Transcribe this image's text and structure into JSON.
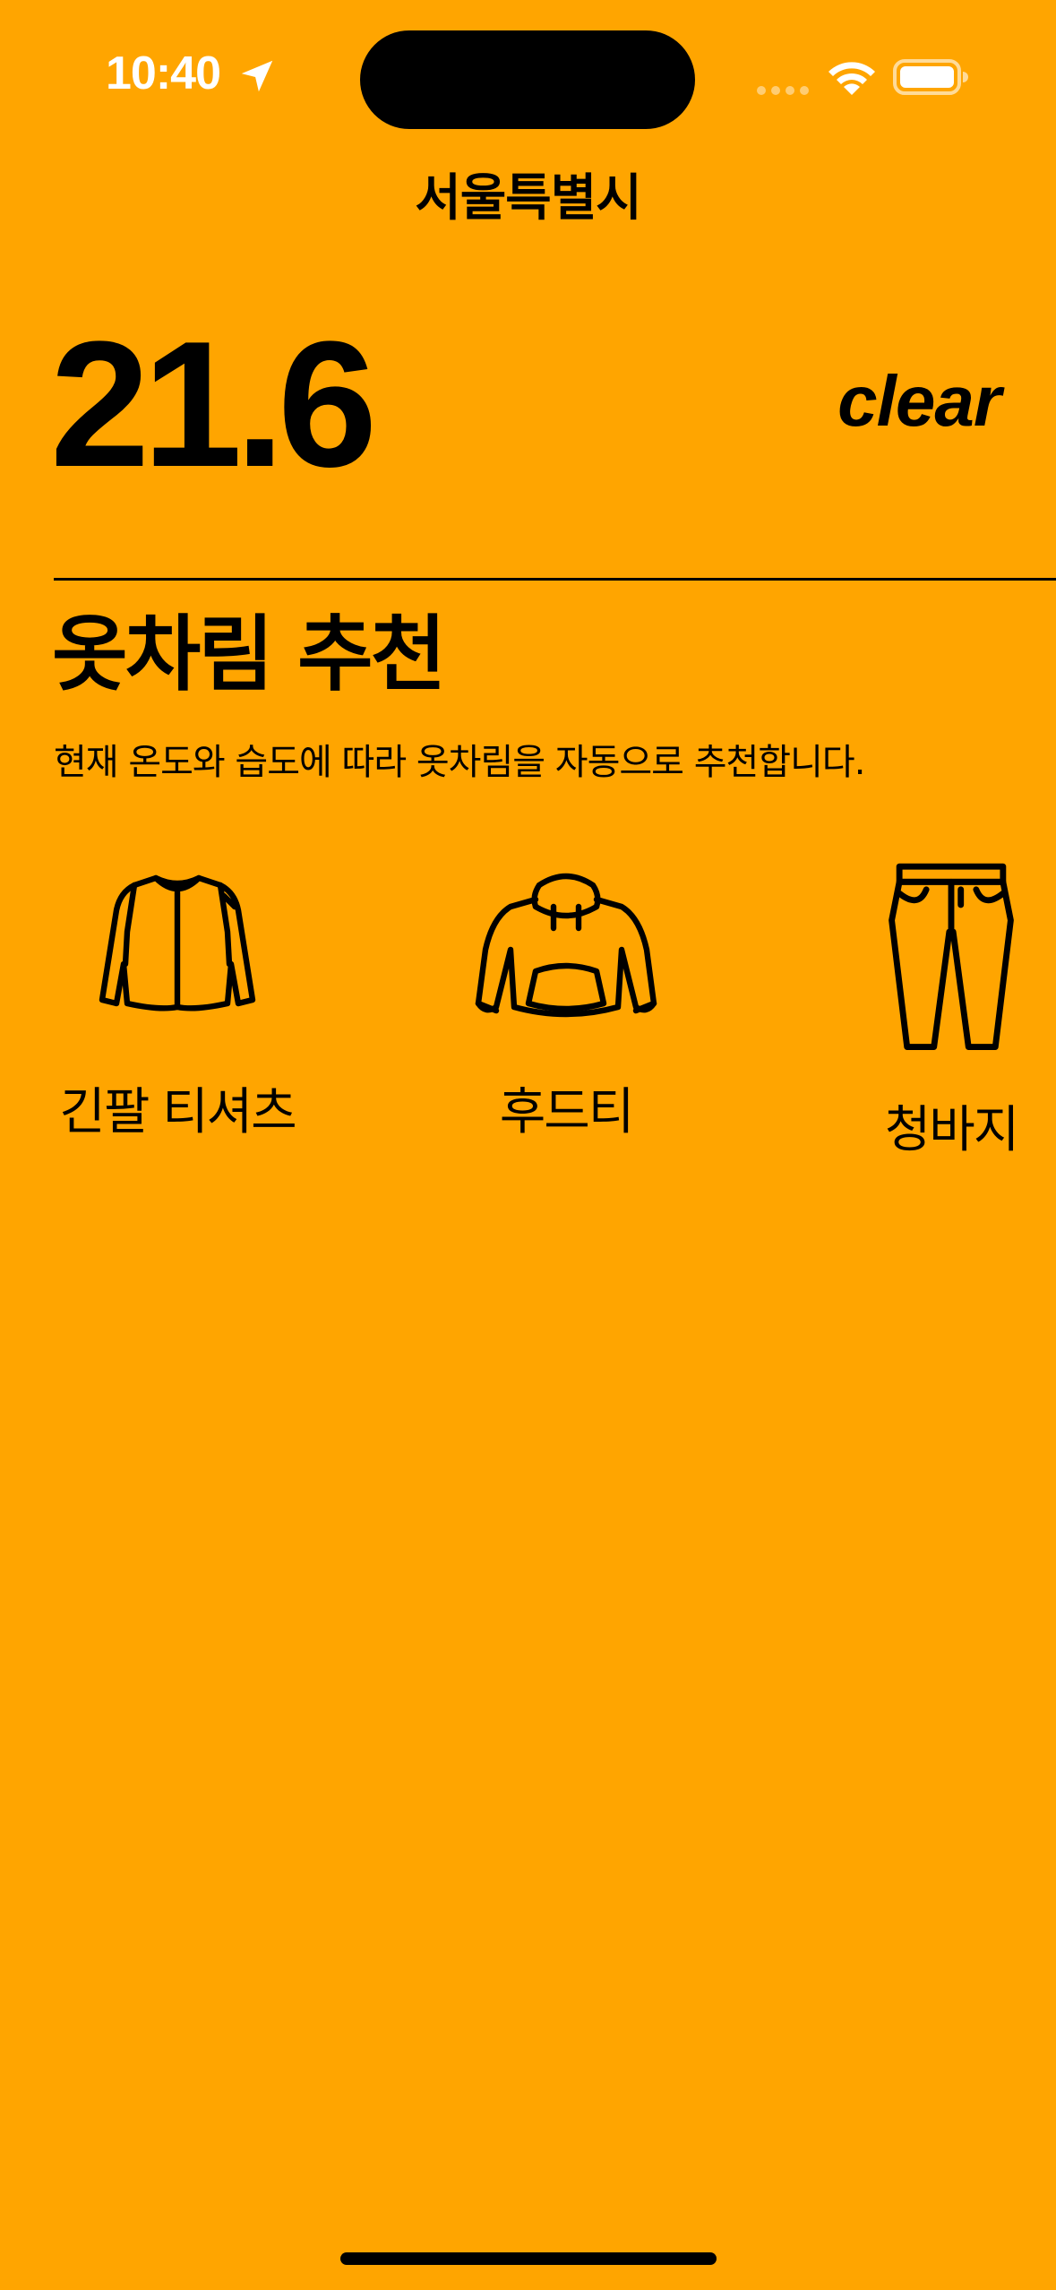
{
  "status_bar": {
    "time": "10:40"
  },
  "header": {
    "city": "서울특별시"
  },
  "weather": {
    "temperature": "21.6",
    "condition": "clear"
  },
  "recommendation": {
    "title": "옷차림 추천",
    "description": "현재 온도와 습도에 따라 옷차림을 자동으로 추천합니다.",
    "items": [
      {
        "label": "긴팔 티셔츠",
        "icon": "long-sleeve-shirt-icon"
      },
      {
        "label": "후드티",
        "icon": "hoodie-icon"
      },
      {
        "label": "청바지",
        "icon": "jeans-icon"
      }
    ]
  },
  "colors": {
    "background": "#FFA500",
    "text": "#000000"
  }
}
